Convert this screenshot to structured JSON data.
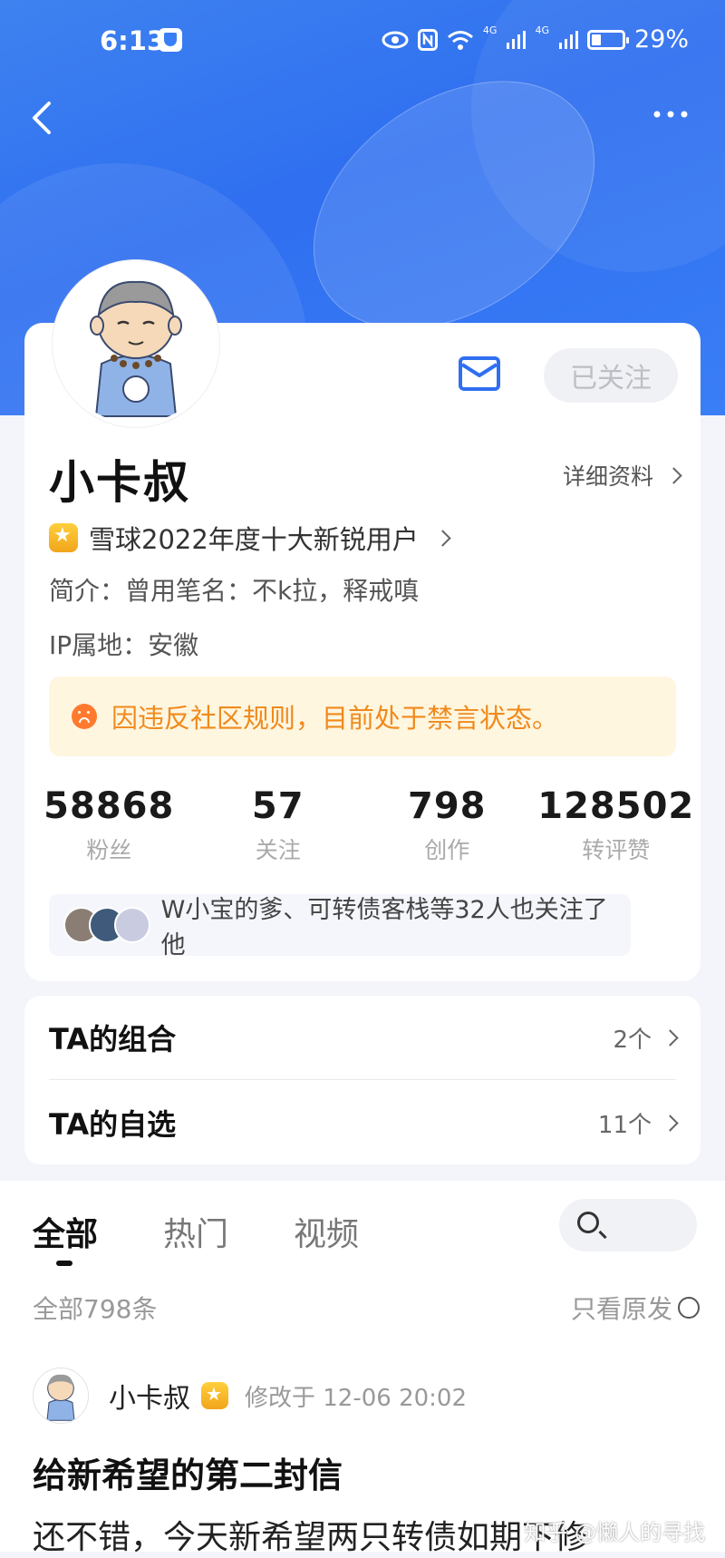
{
  "status_bar": {
    "time": "6:13",
    "battery": "29%",
    "network_a": "4G",
    "network_b": "4G"
  },
  "profile": {
    "follow_label": "已关注",
    "name": "小卡叔",
    "details_label": "详细资料",
    "award": "雪球2022年度十大新锐用户",
    "bio": "简介：曾用笔名：不k拉，释戒嗔",
    "ip": "IP属地：安徽",
    "ban_notice": "因违反社区规则，目前处于禁言状态。"
  },
  "stats": [
    {
      "value": "58868",
      "label": "粉丝"
    },
    {
      "value": "57",
      "label": "关注"
    },
    {
      "value": "798",
      "label": "创作"
    },
    {
      "value": "128502",
      "label": "转评赞"
    }
  ],
  "mutual_followers": "W小宝的爹、可转债客栈等32人也关注了他",
  "lists": [
    {
      "title": "TA的组合",
      "count": "2个"
    },
    {
      "title": "TA的自选",
      "count": "11个"
    }
  ],
  "feed": {
    "tabs": [
      "全部",
      "热门",
      "视频"
    ],
    "total": "全部798条",
    "only_original": "只看原发",
    "post": {
      "author": "小卡叔",
      "time": "修改于 12-06 20:02",
      "title": "给新希望的第二封信",
      "body": "还不错，今天新希望两只转债如期下修"
    },
    "watermark": "知乎 @懒人的寻找"
  },
  "colors": {
    "brand_blue": "#3a7ef6",
    "warning_orange": "#f08a1c"
  }
}
